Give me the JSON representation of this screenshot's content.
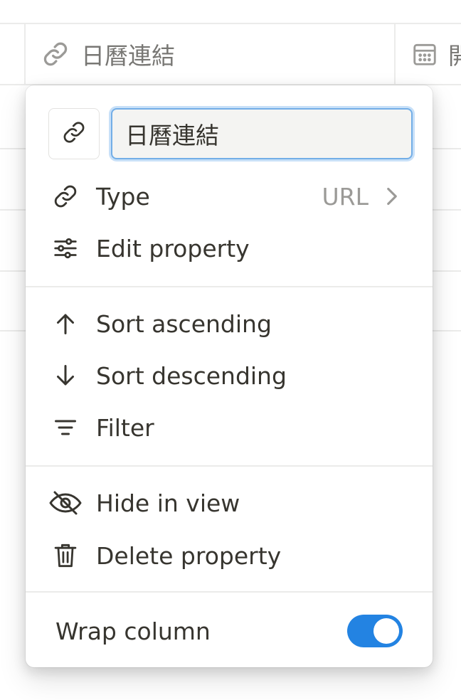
{
  "table": {
    "columns": [
      {
        "label": "日曆連結",
        "icon": "link-icon"
      },
      {
        "label": "開",
        "icon": "calendar-icon"
      }
    ]
  },
  "menu": {
    "property_name": "日曆連結",
    "property_icon": "link-icon",
    "items": [
      {
        "id": "type",
        "label": "Type",
        "value": "URL",
        "icon": "link-icon"
      },
      {
        "id": "edit",
        "label": "Edit property",
        "icon": "sliders-icon"
      }
    ],
    "sort_items": [
      {
        "id": "asc",
        "label": "Sort ascending",
        "icon": "arrow-up-icon"
      },
      {
        "id": "desc",
        "label": "Sort descending",
        "icon": "arrow-down-icon"
      },
      {
        "id": "filter",
        "label": "Filter",
        "icon": "filter-icon"
      }
    ],
    "view_items": [
      {
        "id": "hide",
        "label": "Hide in view",
        "icon": "eye-off-icon"
      },
      {
        "id": "delete",
        "label": "Delete property",
        "icon": "trash-icon"
      }
    ],
    "wrap": {
      "label": "Wrap column",
      "enabled": true
    }
  },
  "colors": {
    "accent": "#2383e2",
    "text": "#37352f",
    "muted": "#9b9a97"
  }
}
